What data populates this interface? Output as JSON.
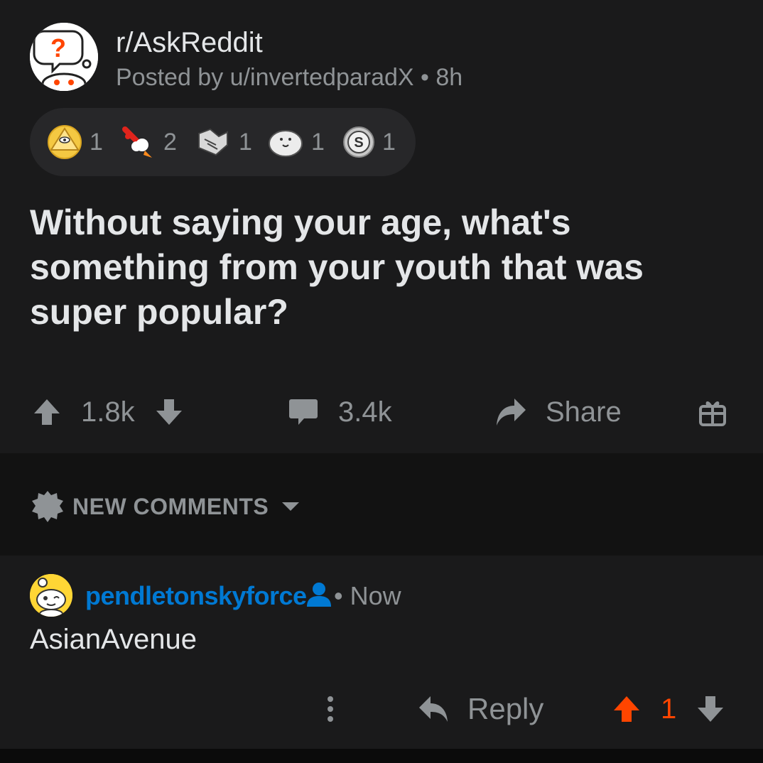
{
  "post": {
    "subreddit": "r/AskReddit",
    "posted_by": "Posted by u/invertedparadX • 8h",
    "title": "Without saying your age, what's something from your youth that was super popular?",
    "awards": [
      {
        "icon": "all-seeing-upvote-icon",
        "count": "1"
      },
      {
        "icon": "rocket-like-icon",
        "count": "2"
      },
      {
        "icon": "bravo-handshake-icon",
        "count": "1"
      },
      {
        "icon": "seal-icon",
        "count": "1"
      },
      {
        "icon": "silver-coin-icon",
        "count": "1"
      }
    ],
    "upvotes": "1.8k",
    "comments": "3.4k",
    "share_label": "Share"
  },
  "sort": {
    "label": "NEW COMMENTS"
  },
  "comment": {
    "username": "pendletonskyforce",
    "meta": "• Now",
    "body": "AsianAvenue",
    "reply_label": "Reply",
    "score": "1"
  },
  "colors": {
    "background": "#1a1a1b",
    "username": "#0079d3",
    "upvoted": "#ff4500",
    "muted": "#8f9396"
  }
}
